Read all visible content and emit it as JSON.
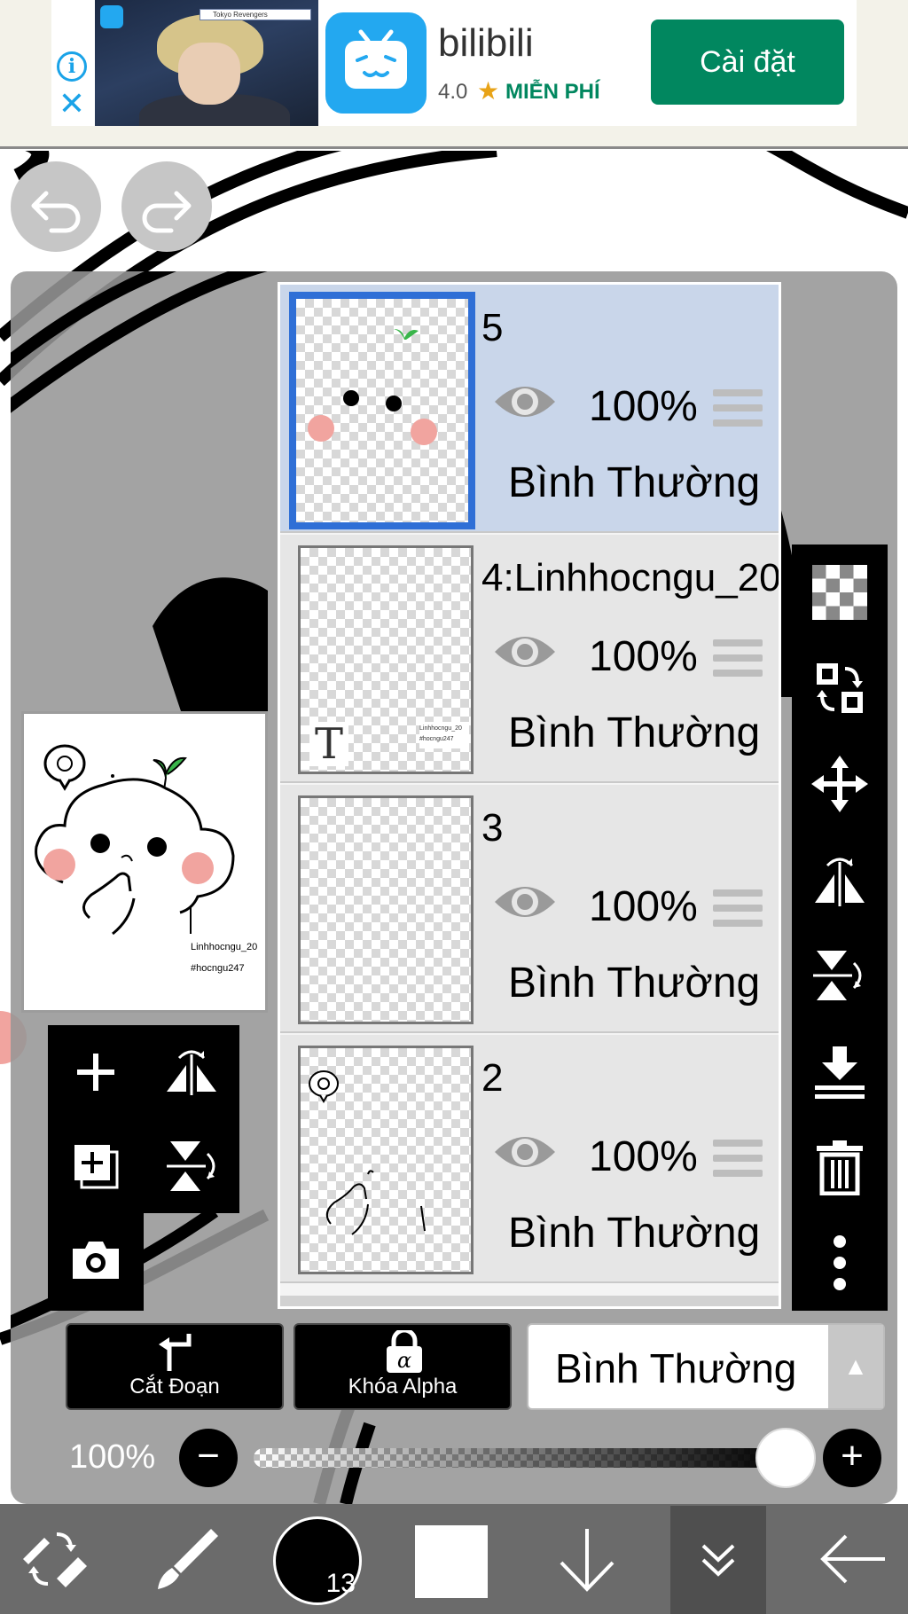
{
  "ad": {
    "app_name": "bilibili",
    "rating": "4.0",
    "price_label": "MIỄN PHÍ",
    "install_label": "Cài đặt",
    "thumbnail_search_text": "Tokyo Revengers",
    "info_icon": "info-icon",
    "close_icon": "close-icon",
    "accent_color": "#01875f"
  },
  "history": {
    "undo_icon": "undo-icon",
    "redo_icon": "redo-icon"
  },
  "preview": {
    "caption_line1": "Linhhocngu_20",
    "caption_line2": "#hocngu247"
  },
  "layers": [
    {
      "name": "5",
      "opacity": "100%",
      "blend_mode": "Bình Thường",
      "selected": true
    },
    {
      "name": "4:Linhhocngu_20",
      "opacity": "100%",
      "blend_mode": "Bình Thường",
      "selected": false,
      "thumb_glyph": "T"
    },
    {
      "name": "3",
      "opacity": "100%",
      "blend_mode": "Bình Thường",
      "selected": false
    },
    {
      "name": "2",
      "opacity": "100%",
      "blend_mode": "Bình Thường",
      "selected": false
    }
  ],
  "right_tools": [
    "transparency-icon",
    "swap-layer-icon",
    "move-icon",
    "flip-horizontal-icon",
    "flip-vertical-icon",
    "merge-down-icon",
    "trash-icon",
    "more-vertical-icon"
  ],
  "left_tools": [
    "add-layer-icon",
    "flip-layer-horizontal-icon",
    "duplicate-layer-icon",
    "flip-layer-vertical-icon",
    "camera-icon"
  ],
  "bottom_buttons": {
    "clipping_label": "Cắt Đoạn",
    "alpha_lock_label": "Khóa Alpha",
    "blend_mode_value": "Bình Thường"
  },
  "opacity": {
    "label": "100%",
    "value_percent": 100,
    "minus": "−",
    "plus": "+"
  },
  "toolbar": {
    "brush_size": "13",
    "items": [
      "transform-tool-icon",
      "brush-icon",
      "brush-size-indicator",
      "color-swatch",
      "arrow-down-icon",
      "layers-collapse-icon",
      "back-arrow-icon"
    ],
    "primary_color": "#000000",
    "secondary_color": "#ffffff"
  }
}
